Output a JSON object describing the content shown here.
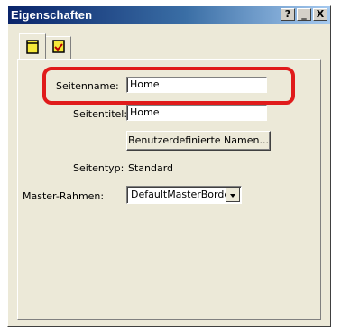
{
  "window": {
    "title": "Eigenschaften",
    "buttons": {
      "help": "?",
      "minimize": "_",
      "close": "X"
    }
  },
  "tabs": [
    {
      "icon": "page-icon",
      "active": true
    },
    {
      "icon": "page-checked-icon",
      "active": false
    }
  ],
  "form": {
    "seitenname": {
      "label": "Seitenname:",
      "value": "Home"
    },
    "seitentitel": {
      "label": "Seitentitel:",
      "value": "Home"
    },
    "custom_names_button": "Benutzerdefinierte Namen...",
    "seitentyp": {
      "label": "Seitentyp:",
      "value": "Standard"
    },
    "master_rahmen": {
      "label": "Master-Rahmen:",
      "value": "DefaultMasterBorder"
    }
  },
  "colors": {
    "titlebar_start": "#0a246a",
    "highlight": "#e01b1b",
    "window_bg": "#ece9d8"
  }
}
